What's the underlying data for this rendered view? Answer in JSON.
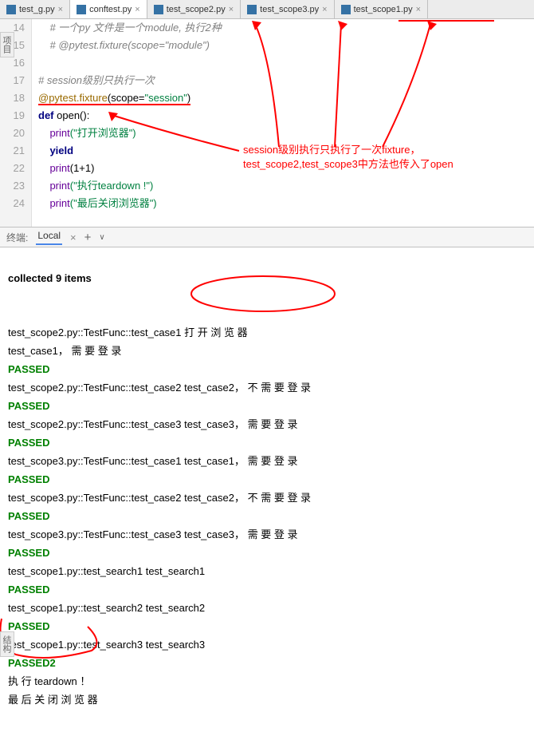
{
  "tabs": [
    {
      "name": "test_g.py",
      "active": false
    },
    {
      "name": "conftest.py",
      "active": true
    },
    {
      "name": "test_scope2.py",
      "active": false
    },
    {
      "name": "test_scope3.py",
      "active": false
    },
    {
      "name": "test_scope1.py",
      "active": false
    }
  ],
  "gutter": [
    "14",
    "15",
    "16",
    "17",
    "18",
    "19",
    "20",
    "21",
    "22",
    "23",
    "24"
  ],
  "code": {
    "l14": "# 一个py 文件是一个module, 执行2种",
    "l15": "# @pytest.fixture(scope=\"module\")",
    "l17": "# session级别只执行一次",
    "l18_dec": "@pytest.fixture",
    "l18_arg": "(scope=",
    "l18_str": "\"session\"",
    "l18_close": ")",
    "l19_def": "def ",
    "l19_name": "open",
    "l19_paren": "():",
    "l20_fn": "print",
    "l20_str": "(\"打开浏览器\")",
    "l21": "yield",
    "l22_fn": "print",
    "l22_arg": "(1+1)",
    "l23_fn": "print",
    "l23_str": "(\"执行teardown !\")",
    "l24_fn": "print",
    "l24_str": "(\"最后关闭浏览器\")"
  },
  "annotation": {
    "line1": "session级别执行只执行了一次fixture，",
    "line2": "test_scope2,test_scope3中方法也传入了open"
  },
  "terminal_bar": {
    "label": "终端:",
    "tab": "Local",
    "add": "+",
    "dd": "∨"
  },
  "terminal": {
    "collected": "collected 9 items",
    "blank": "",
    "l1": "test_scope2.py::TestFunc::test_case1 打 开 浏 览 器",
    "l2": "test_case1， 需 要 登 录",
    "p1": "PASSED",
    "l3": "test_scope2.py::TestFunc::test_case2 test_case2， 不 需 要 登 录",
    "p2": "PASSED",
    "l4": "test_scope2.py::TestFunc::test_case3 test_case3， 需 要 登 录",
    "p3": "PASSED",
    "l5": "test_scope3.py::TestFunc::test_case1 test_case1， 需 要 登 录",
    "p4": "PASSED",
    "l6": "test_scope3.py::TestFunc::test_case2 test_case2， 不 需 要 登 录",
    "p5": "PASSED",
    "l7": "test_scope3.py::TestFunc::test_case3 test_case3， 需 要 登 录",
    "p6": "PASSED",
    "l8": "test_scope1.py::test_search1 test_search1",
    "p7": "PASSED",
    "l9": "test_scope1.py::test_search2 test_search2",
    "p8": "PASSED",
    "l10": "test_scope1.py::test_search3 test_search3",
    "p9": "PASSED2",
    "l11": "执 行 teardown ！",
    "l12": "最 后 关 闭 浏 览 器"
  },
  "side": {
    "top": "项目",
    "bottom": "结构"
  }
}
